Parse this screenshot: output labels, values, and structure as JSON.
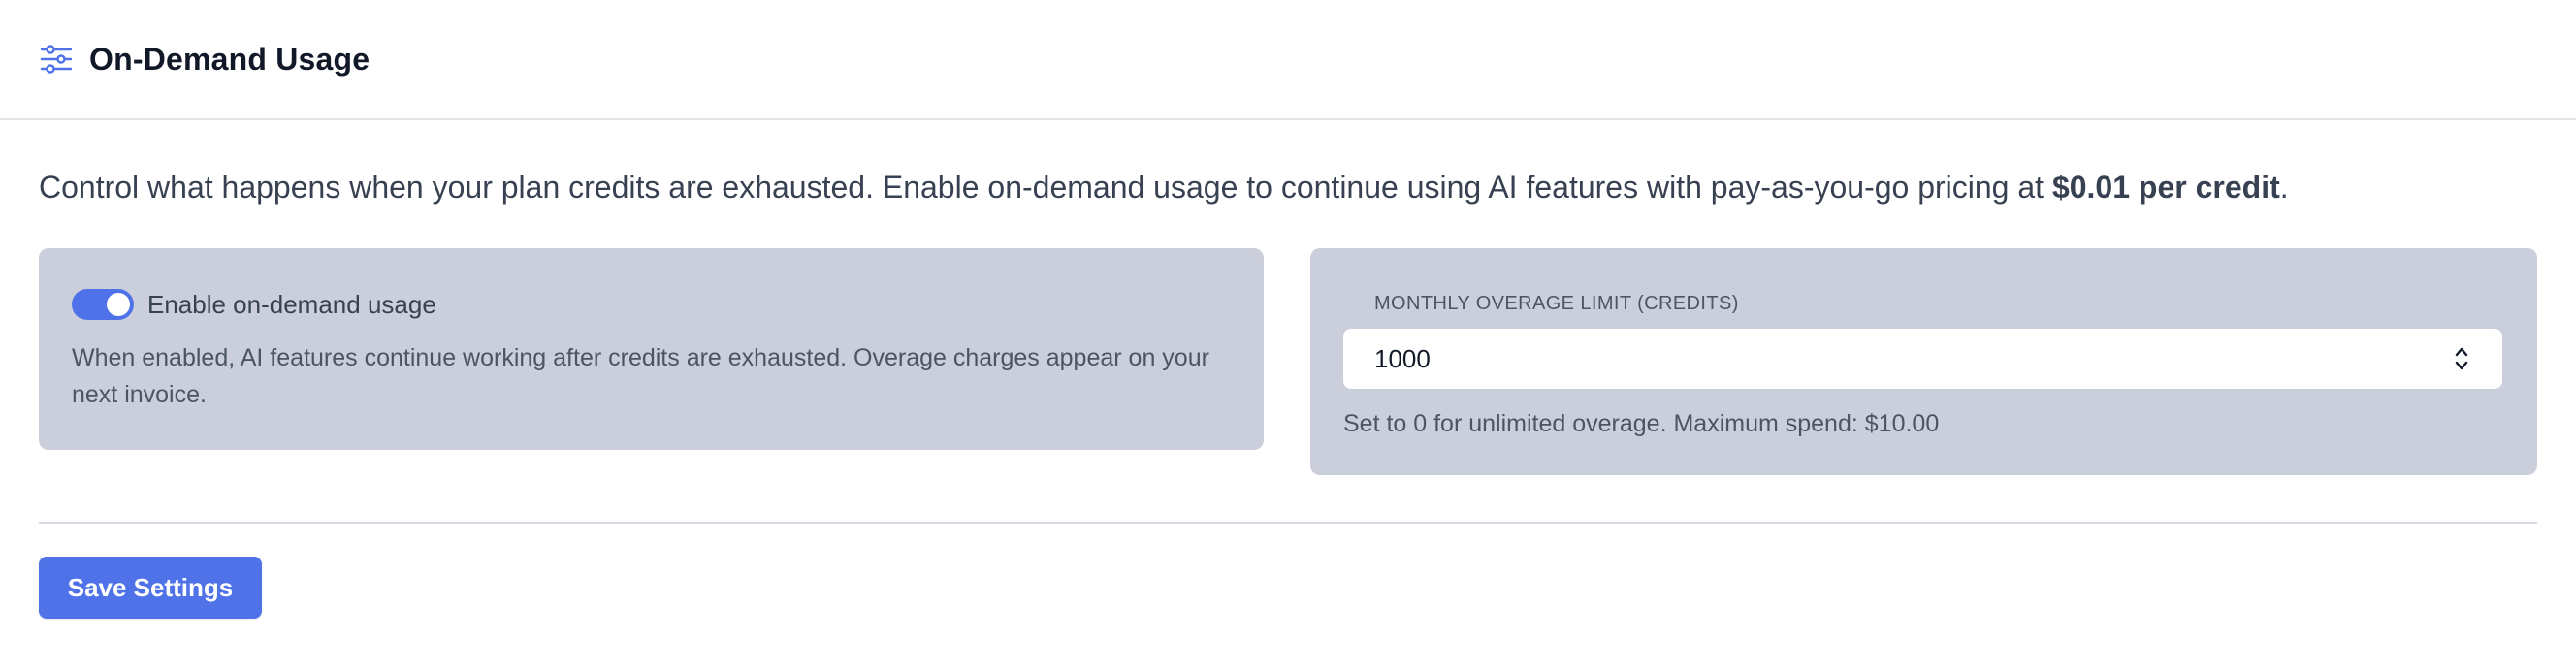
{
  "header": {
    "icon": "sliders-icon",
    "title": "On-Demand Usage"
  },
  "description": {
    "text": "Control what happens when your plan credits are exhausted. Enable on-demand usage to continue using AI features with pay-as-you-go pricing at ",
    "price_emphasis": "$0.01 per credit",
    "suffix": "."
  },
  "toggle_card": {
    "enabled": true,
    "label": "Enable on-demand usage",
    "helper": "When enabled, AI features continue working after credits are exhausted. Overage charges appear on your next invoice."
  },
  "limit_card": {
    "label": "Monthly Overage Limit (Credits)",
    "value": "1000",
    "help": "Set to 0 for unlimited overage. Maximum spend: $10.00"
  },
  "actions": {
    "save_label": "Save Settings"
  },
  "colors": {
    "accent": "#4f72e8",
    "card_background": "#cbcfdb",
    "divider": "#d6d9df"
  }
}
